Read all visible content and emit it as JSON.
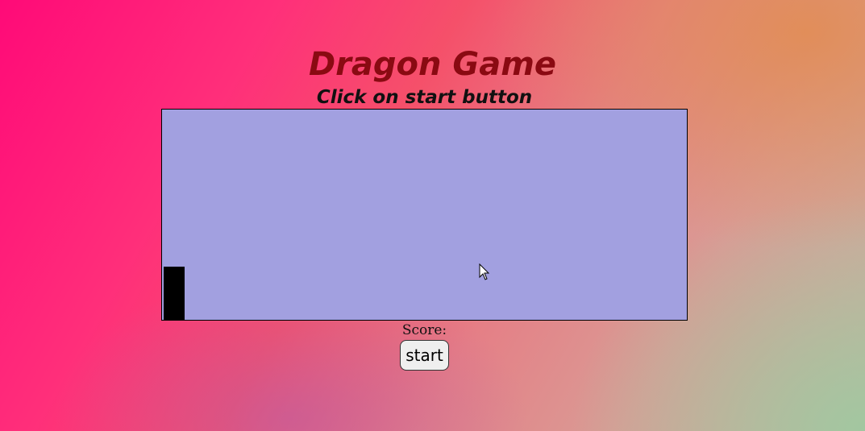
{
  "header": {
    "title": "Dragon Game",
    "subtitle": "Click on start button"
  },
  "game": {
    "background_color": "#a2a0e0",
    "player_color": "#000000"
  },
  "score": {
    "label": "Score:",
    "value": ""
  },
  "controls": {
    "start_label": "start"
  },
  "colors": {
    "title": "#8a0a12",
    "subtitle": "#111111"
  }
}
